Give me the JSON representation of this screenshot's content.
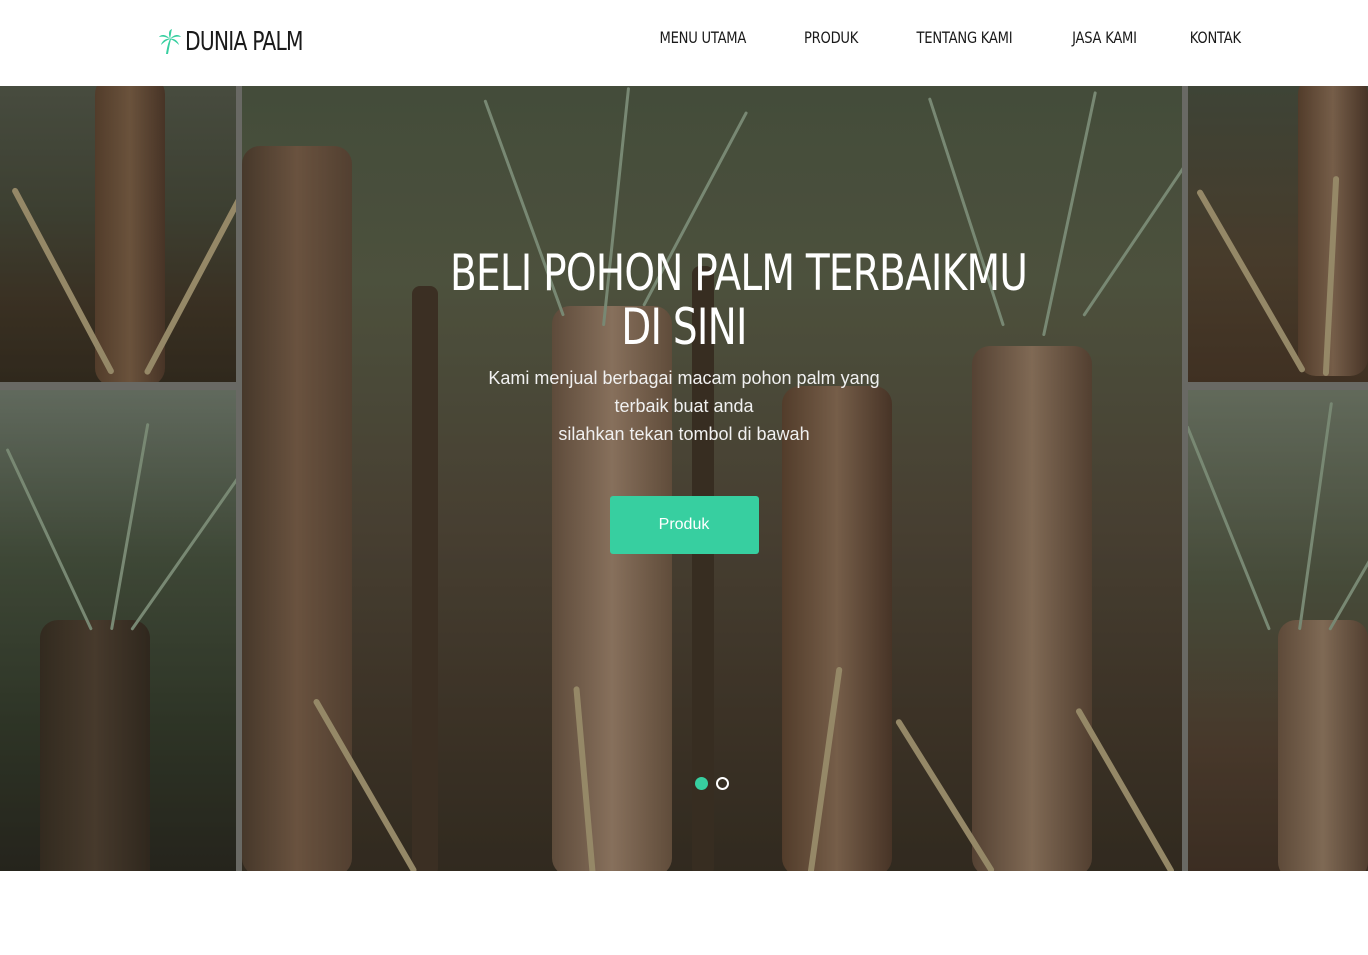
{
  "brand": {
    "name": "DUNIA PALM",
    "icon": "palm-tree-icon",
    "accent": "#37cfa0"
  },
  "nav": {
    "items": [
      {
        "label": "MENU UTAMA"
      },
      {
        "label": "PRODUK"
      },
      {
        "label": "TENTANG KAMI"
      },
      {
        "label": "JASA KAMI"
      },
      {
        "label": "KONTAK"
      }
    ]
  },
  "hero": {
    "title_line1": "BELI POHON PALM TERBAIKMU",
    "title_line2": "DI SINI",
    "subtitle_line1": "Kami menjual berbagai macam pohon palm yang terbaik buat anda",
    "subtitle_line2": "silahkan tekan tombol di bawah",
    "button_label": "Produk",
    "button_color": "#37cfa0",
    "slides": {
      "count": 2,
      "active": 1
    }
  }
}
